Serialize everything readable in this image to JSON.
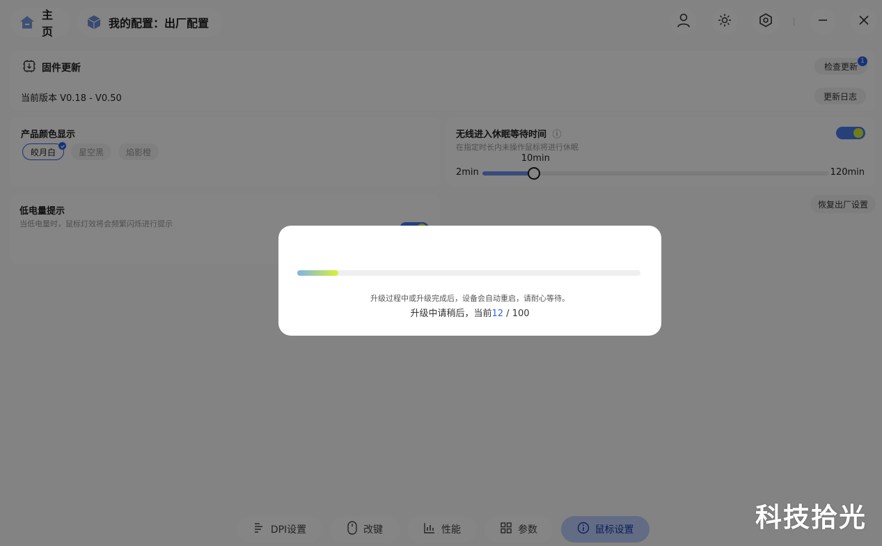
{
  "header": {
    "home_label": "主页",
    "config_label": "我的配置：出厂配置",
    "icons": [
      "user-icon",
      "brightness-icon",
      "settings-hexagon-icon",
      "minimize-icon",
      "close-icon"
    ]
  },
  "firmware": {
    "title": "固件更新",
    "version_text": "当前版本 V0.18 - V0.50",
    "check_update_label": "检查更新",
    "badge_count": "1",
    "changelog_label": "更新日志"
  },
  "product_color": {
    "title": "产品颜色显示",
    "options": [
      "皎月白",
      "星空黑",
      "焰影橙"
    ],
    "selected": "皎月白"
  },
  "sleep": {
    "title": "无线进入休眠等待时间",
    "subtitle": "在指定时长内未操作鼠标将进行休眠",
    "min_label": "2min",
    "max_label": "120min",
    "value_label": "10min",
    "value": 10,
    "min": 2,
    "max": 120,
    "enabled": true
  },
  "reset_label": "恢复出厂设置",
  "low_battery": {
    "title": "低电量提示",
    "subtitle": "当低电量时，鼠标灯效将会频繁闪烁进行提示",
    "enabled": true
  },
  "bottom_nav": {
    "items": [
      {
        "label": "DPI设置",
        "icon": "dpi-bars-icon"
      },
      {
        "label": "改键",
        "icon": "mouse-icon"
      },
      {
        "label": "性能",
        "icon": "performance-chart-icon"
      },
      {
        "label": "参数",
        "icon": "grid-icon"
      },
      {
        "label": "鼠标设置",
        "icon": "info-circle-icon"
      }
    ],
    "active": "鼠标设置"
  },
  "modal": {
    "note": "升级过程中或升级完成后，设备会自动重启，请耐心等待。",
    "status_prefix": "升级中请稍后，当前",
    "current": "12",
    "total_text": " / 100",
    "progress_fraction": 0.12
  },
  "watermark": "科技拾光",
  "colors": {
    "accent": "#2c63e6",
    "toggle_knob": "#d9f036",
    "nav_active_bg": "#bed0ff"
  }
}
